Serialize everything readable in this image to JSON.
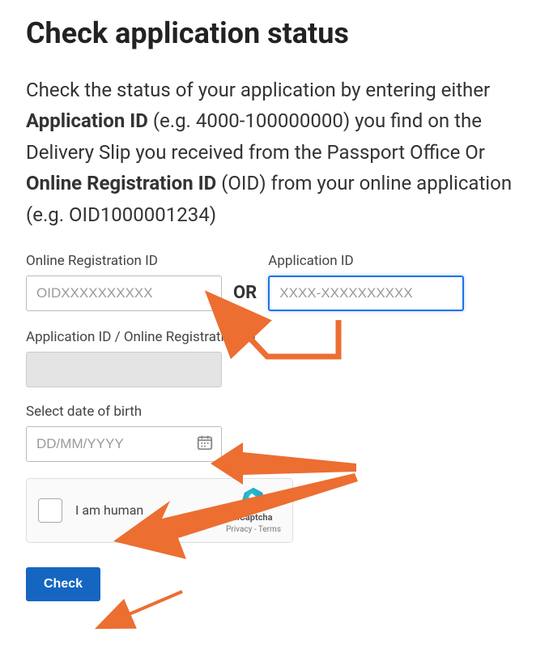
{
  "title": "Check application status",
  "intro": {
    "prefix": "Check the status of your application by entering either ",
    "bold1": "Application ID",
    "middle1": " (e.g. 4000-100000000) you find on the Delivery Slip you received from the Passport Office Or ",
    "bold2": "Online Registration ID",
    "middle2": " (OID) from your online application (e.g. OID1000001234)"
  },
  "labels": {
    "oid": "Online Registration ID",
    "appid": "Application ID",
    "combined": "Application ID / Online Registration ID",
    "dob": "Select date of birth",
    "or": "OR"
  },
  "placeholders": {
    "oid": "OIDXXXXXXXXXX",
    "appid": "XXXX-XXXXXXXXXX",
    "dob": "DD/MM/YYYY"
  },
  "captcha": {
    "label": "I am human",
    "brand": "hCaptcha",
    "links": "Privacy - Terms"
  },
  "button": "Check",
  "colors": {
    "accent": "#1566c0",
    "arrow": "#ec6e31",
    "focus": "#1a73e8"
  }
}
